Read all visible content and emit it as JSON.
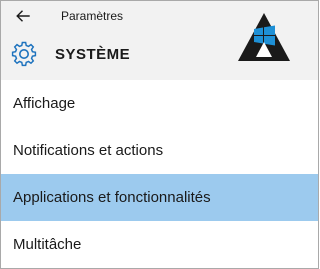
{
  "window": {
    "title": "Paramètres",
    "back_icon": "back-arrow-icon"
  },
  "header": {
    "section_icon": "gear-icon",
    "section_title": "SYSTÈME",
    "logo_icon": "windows-logo-watermark",
    "accent_color": "#1e90d6"
  },
  "menu": {
    "items": [
      {
        "label": "Affichage",
        "selected": false
      },
      {
        "label": "Notifications et actions",
        "selected": false
      },
      {
        "label": "Applications et fonctionnalités",
        "selected": true
      },
      {
        "label": "Multitâche",
        "selected": false
      }
    ],
    "selected_color": "#9ccaee"
  }
}
